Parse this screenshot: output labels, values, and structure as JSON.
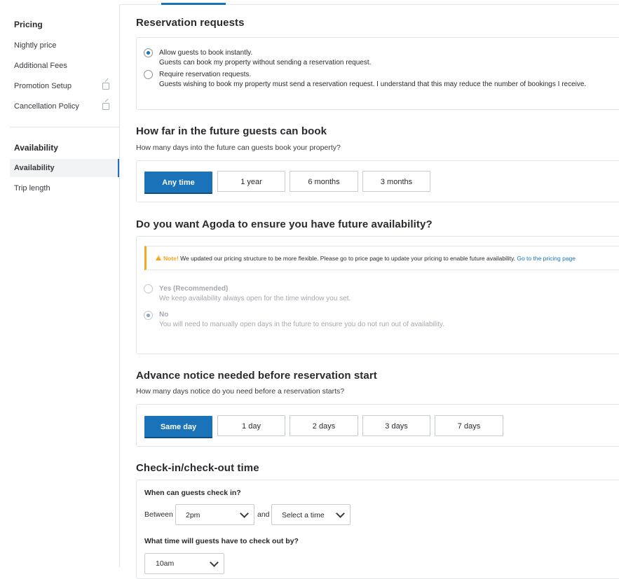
{
  "sidebar": {
    "pricing_heading": "Pricing",
    "pricing_items": [
      {
        "label": "Nightly price",
        "external": false
      },
      {
        "label": "Additional Fees",
        "external": false
      },
      {
        "label": "Promotion Setup",
        "external": true
      },
      {
        "label": "Cancellation Policy",
        "external": true
      }
    ],
    "availability_heading": "Availability",
    "availability_items": [
      {
        "label": "Availability",
        "active": true
      },
      {
        "label": "Trip length",
        "active": false
      }
    ]
  },
  "reservation": {
    "title": "Reservation requests",
    "options": [
      {
        "label": "Allow guests to book instantly.",
        "desc": "Guests can book my property without sending a reservation request.",
        "selected": true
      },
      {
        "label": "Require reservation requests.",
        "desc": "Guests wishing to book my property must send a reservation request. I understand that this may reduce the number of bookings I receive.",
        "selected": false
      }
    ]
  },
  "future": {
    "title": "How far in the future guests can book",
    "subtitle": "How many days into the future can guests book your property?",
    "options": [
      "Any time",
      "1 year",
      "6 months",
      "3 months"
    ],
    "selected": "Any time"
  },
  "ensure": {
    "title": "Do you want Agoda to ensure you have future availability?",
    "note_label": "Note!",
    "note_text": "We updated our pricing structure to be more flexible. Please go to price page to update your pricing to enable future availability.",
    "note_link": "Go to the pricing page",
    "options": [
      {
        "label": "Yes (Recommended)",
        "desc": "We keep availability always open for the time window you set.",
        "selected": false
      },
      {
        "label": "No",
        "desc": "You will need to manually open days in the future to ensure you do not run out of availability.",
        "selected": true
      }
    ]
  },
  "advance": {
    "title": "Advance notice needed before reservation start",
    "subtitle": "How many days notice do you need before a reservation starts?",
    "options": [
      "Same day",
      "1 day",
      "2 days",
      "3 days",
      "7 days"
    ],
    "selected": "Same day"
  },
  "checkin": {
    "title": "Check-in/check-out time",
    "checkin_question": "When can guests check in?",
    "between_label": "Between",
    "and_label": "and",
    "from_value": "2pm",
    "to_value": "Select a time",
    "checkout_question": "What time will guests have to check out by?",
    "checkout_value": "10am"
  },
  "colors": {
    "accent": "#1a73b9",
    "warning": "#f5a623"
  }
}
